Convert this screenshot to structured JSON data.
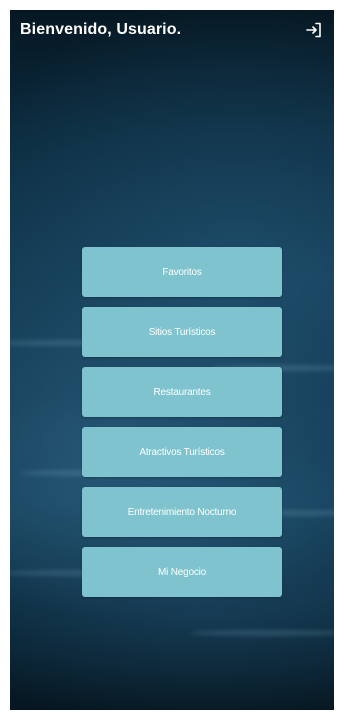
{
  "header": {
    "welcome_text": "Bienvenido, Usuario.",
    "logout_icon": "logout-icon"
  },
  "menu": {
    "items": [
      {
        "label": "Favoritos"
      },
      {
        "label": "Sitios Turísticos"
      },
      {
        "label": "Restaurantes"
      },
      {
        "label": "Atractivos Turísticos"
      },
      {
        "label": "Entretenimiento Nocturno"
      },
      {
        "label": "Mi Negocio"
      }
    ]
  },
  "colors": {
    "button_bg": "#7ec3cd",
    "button_text": "#ffffff",
    "background_dark": "#0b2a3d"
  }
}
